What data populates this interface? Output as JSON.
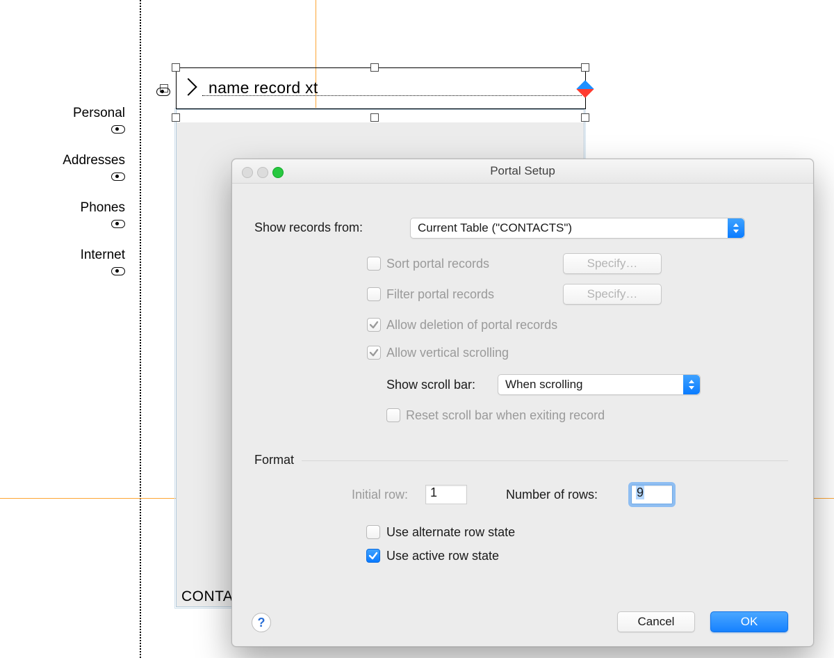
{
  "sidebar": {
    "items": [
      "Personal",
      "Addresses",
      "Phones",
      "Internet"
    ]
  },
  "selectedField": {
    "text": "name record xt"
  },
  "cutoffLabel": "CONTA",
  "dialog": {
    "title": "Portal Setup",
    "showRecordsLabel": "Show records from:",
    "showRecordsValue": "Current Table (\"CONTACTS\")",
    "sortLabel": "Sort portal records",
    "filterLabel": "Filter portal records",
    "specifyLabel": "Specify…",
    "allowDeleteLabel": "Allow deletion of portal records",
    "allowScrollLabel": "Allow vertical scrolling",
    "scrollBarLabel": "Show scroll bar:",
    "scrollBarValue": "When scrolling",
    "resetLabel": "Reset scroll bar when exiting record",
    "formatHeader": "Format",
    "initialRowLabel": "Initial row:",
    "initialRowValue": "1",
    "numRowsLabel": "Number of rows:",
    "numRowsValue": "9",
    "altRowLabel": "Use alternate row state",
    "activeRowLabel": "Use active row state",
    "cancel": "Cancel",
    "ok": "OK",
    "help": "?"
  }
}
